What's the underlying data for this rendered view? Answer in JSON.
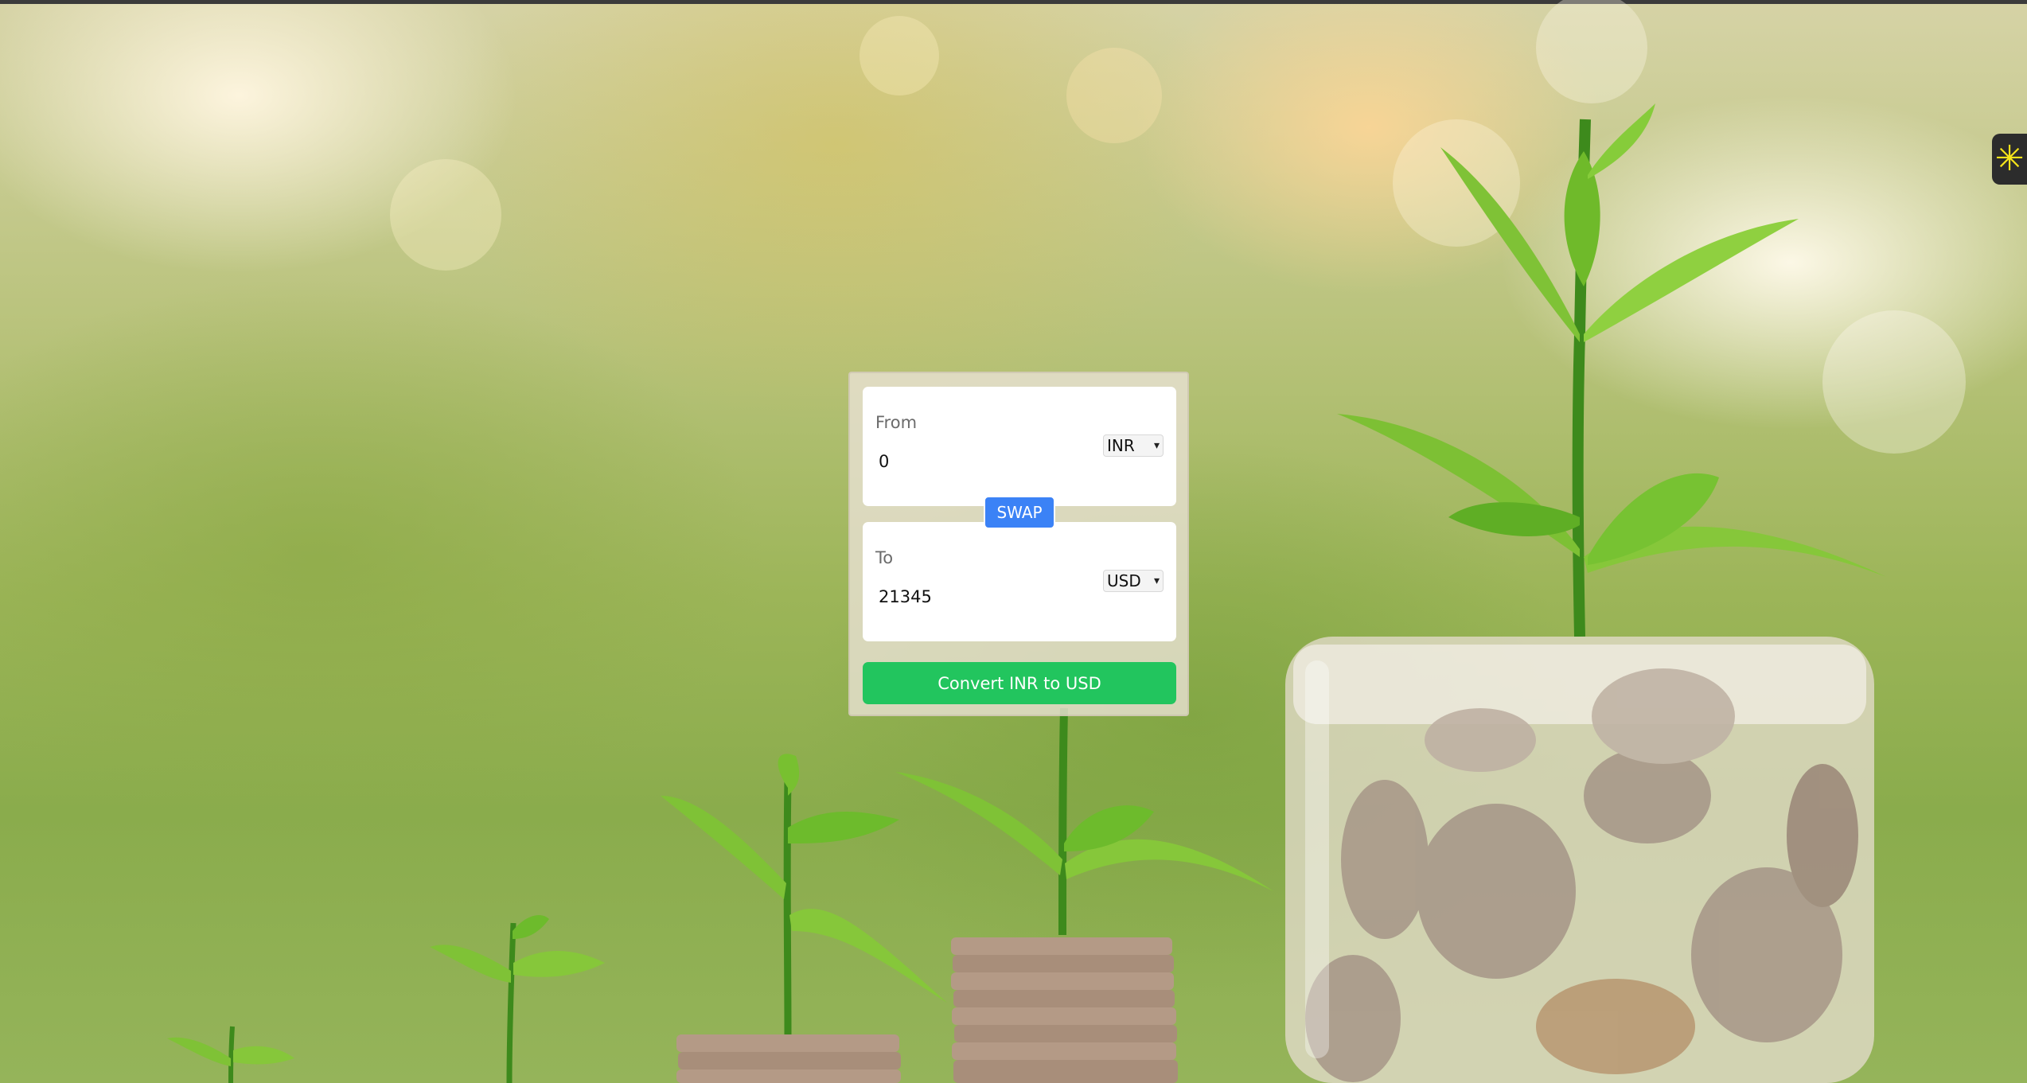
{
  "colors": {
    "swap_button": "#3b82f6",
    "convert_button": "#22c55e",
    "card_background": "#e8e0d2",
    "panel_background": "#ffffff"
  },
  "side_widget": {
    "icon": "asterisk-icon",
    "glyph": "✳"
  },
  "converter": {
    "from": {
      "label": "From",
      "amount": "0",
      "currency": "INR"
    },
    "swap_label": "SWAP",
    "to": {
      "label": "To",
      "amount": "21345",
      "currency": "USD"
    },
    "convert_label": "Convert INR to USD"
  },
  "background": {
    "description_icon": "plants-growing-from-coins-photo"
  }
}
